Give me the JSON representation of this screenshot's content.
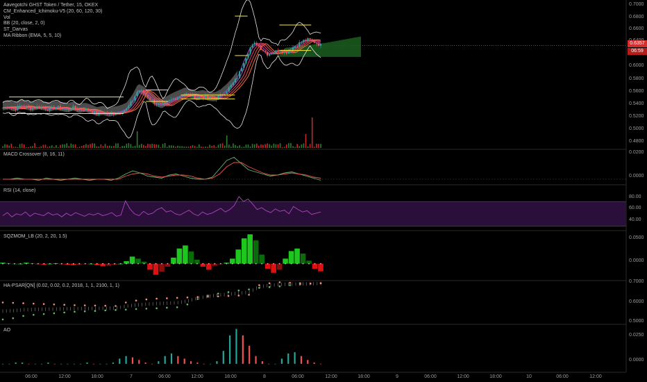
{
  "main_legend": [
    "Aavegotchi GHST Token / Tether, 15, OKEX",
    "CM_Enhanced_Ichimoku-V5 (20, 60, 120, 30)",
    "Vol",
    "BB (20, close, 2, 0)",
    "ST_Darvas",
    "MA Ribbon (EMA, 5, 5, 10)"
  ],
  "pane_labels": {
    "macd": "MACD Crossover (8, 16, 11)",
    "rsi": "RSI (14, close)",
    "sqzmom": "SQZMOM_LB (20, 2, 20, 1.5)",
    "hapsar": "HA-PSAR[QN] (0.02, 0.02, 0.2, 2018, 1, 1, 2100, 1, 1)",
    "ao": "AO"
  },
  "price_badge": "0.6357",
  "countdown_badge": "06:59",
  "y_ticks": {
    "main": [
      "0.7000",
      "0.6800",
      "0.6600",
      "0.6400",
      "0.6200",
      "0.6000",
      "0.5800",
      "0.5600",
      "0.5400",
      "0.5200",
      "0.5000",
      "0.4800"
    ],
    "macd": [
      "0.0200",
      "0.0000"
    ],
    "rsi": [
      "80.00",
      "60.00",
      "40.00"
    ],
    "sqzmom": [
      "0.0500",
      "0.0000"
    ],
    "hapsar": [
      "0.7000",
      "0.6000",
      "0.5000"
    ],
    "ao": [
      "0.0250",
      "0.0000"
    ]
  },
  "x_ticks": [
    "06:00",
    "12:00",
    "18:00",
    "7",
    "06:00",
    "12:00",
    "18:00",
    "8",
    "06:00",
    "12:00",
    "18:00",
    "9",
    "06:00",
    "12:00",
    "18:00",
    "10",
    "06:00",
    "12:00"
  ],
  "colors": {
    "up": "#26a69a",
    "down": "#ef5350",
    "bull_volume": "#2e7d32",
    "bear_volume": "#c62828",
    "rsi_line": "#ab47bc",
    "rsi_band": "#2a0f3a",
    "bb_band": "#e8e8e8",
    "darvas": "#ffeb3b",
    "cloud_gray": "#8a8a8a",
    "cloud_green": "#1b5e20",
    "psar_red": "#ff8a80",
    "psar_green": "#66bb6a"
  },
  "chart_data": [
    {
      "type": "candlestick",
      "title": "Aavegotchi GHST Token / Tether, 15, OKEX",
      "ylim": [
        0.475,
        0.705
      ],
      "x_session_ticks": [
        "06:00",
        "12:00",
        "18:00",
        "7",
        "06:00",
        "12:00",
        "18:00",
        "8",
        "06:00",
        "12:00",
        "18:00",
        "9",
        "06:00",
        "12:00",
        "18:00",
        "10",
        "06:00",
        "12:00"
      ],
      "close_path": [
        0.538,
        0.54,
        0.536,
        0.541,
        0.539,
        0.537,
        0.54,
        0.538,
        0.536,
        0.539,
        0.537,
        0.535,
        0.538,
        0.534,
        0.536,
        0.533,
        0.529,
        0.531,
        0.528,
        0.53,
        0.532,
        0.536,
        0.548,
        0.566,
        0.561,
        0.552,
        0.545,
        0.541,
        0.547,
        0.552,
        0.556,
        0.56,
        0.557,
        0.554,
        0.556,
        0.553,
        0.552,
        0.557,
        0.565,
        0.575,
        0.588,
        0.612,
        0.632,
        0.64,
        0.63,
        0.622,
        0.625,
        0.629,
        0.624,
        0.631,
        0.637,
        0.643,
        0.645,
        0.641,
        0.636
      ],
      "last_price": 0.6357,
      "darvas_levels": [
        [
          0.555,
          0.529
        ],
        [
          0.566,
          0.548
        ],
        [
          0.558,
          0.552
        ],
        [
          0.682,
          0.62
        ],
        [
          0.668,
          0.628
        ]
      ]
    },
    {
      "type": "line",
      "title": "MACD Crossover (8, 16, 11)",
      "ylim": [
        -0.004,
        0.028
      ],
      "series": [
        {
          "values": [
            0.0,
            0.0,
            0.001,
            0.0,
            0.0,
            -0.001,
            0.001,
            0.0,
            -0.001,
            0.0,
            0.001,
            0.0,
            -0.001,
            0.0,
            0.0,
            -0.001,
            0.001,
            0.005,
            0.008,
            0.006,
            0.003,
            0.002,
            0.001,
            0.004,
            0.005,
            0.003,
            0.001,
            0.0,
            0.0,
            0.002,
            0.01,
            0.018,
            0.021,
            0.015,
            0.009,
            0.007,
            0.005,
            0.003,
            0.004,
            0.006,
            0.007,
            0.005,
            0.003,
            0.001,
            -0.001
          ]
        },
        {
          "values": [
            0.0,
            0.0,
            0.0,
            0.0,
            0.0,
            0.0,
            0.0,
            0.0,
            0.0,
            0.0,
            0.0,
            0.0,
            0.0,
            0.0,
            0.0,
            0.0,
            0.0,
            0.003,
            0.005,
            0.006,
            0.005,
            0.003,
            0.002,
            0.003,
            0.004,
            0.004,
            0.003,
            0.001,
            0.0,
            0.001,
            0.005,
            0.012,
            0.016,
            0.016,
            0.012,
            0.009,
            0.006,
            0.004,
            0.004,
            0.005,
            0.006,
            0.005,
            0.004,
            0.002,
            0.001
          ]
        }
      ]
    },
    {
      "type": "line",
      "title": "RSI (14, close)",
      "ylim": [
        25,
        95
      ],
      "band": [
        30,
        70
      ],
      "series": [
        {
          "values": [
            47,
            52,
            45,
            50,
            48,
            53,
            46,
            51,
            49,
            47,
            52,
            48,
            50,
            45,
            51,
            47,
            52,
            49,
            46,
            50,
            48,
            51,
            47,
            49,
            52,
            46,
            48,
            71,
            58,
            50,
            47,
            54,
            49,
            51,
            57,
            60,
            53,
            55,
            50,
            48,
            52,
            56,
            50,
            47,
            53,
            49,
            51,
            55,
            59,
            53,
            57,
            64,
            78,
            70,
            74,
            66,
            57,
            60,
            55,
            52,
            58,
            54,
            56,
            50,
            62,
            57,
            53,
            55,
            49,
            51,
            53
          ]
        }
      ]
    },
    {
      "type": "bar",
      "title": "SQZMOM_LB (20, 2, 20, 1.5)",
      "ylim": [
        -0.032,
        0.064
      ],
      "values": [
        0.002,
        0.001,
        0.0,
        0.0,
        0.002,
        0.001,
        -0.001,
        -0.002,
        0.0,
        0.001,
        -0.001,
        -0.002,
        -0.003,
        -0.002,
        -0.001,
        0.0,
        -0.003,
        -0.005,
        -0.004,
        -0.002,
        0.0,
        0.005,
        0.014,
        0.01,
        0.004,
        -0.012,
        -0.022,
        -0.016,
        -0.006,
        0.012,
        0.03,
        0.036,
        0.024,
        0.008,
        -0.006,
        -0.012,
        -0.004,
        -0.001,
        0.002,
        0.01,
        0.028,
        0.05,
        0.058,
        0.046,
        0.018,
        -0.01,
        -0.018,
        -0.012,
        0.01,
        0.025,
        0.03,
        0.02,
        0.006,
        -0.01,
        -0.015
      ]
    },
    {
      "type": "scatter",
      "title": "HA-PSAR[QN] (0.02, 0.02, 0.2, 2018, 1, 1, 2100, 1, 1)",
      "ylim": [
        0.49,
        0.71
      ],
      "series": [
        {
          "values": [
            0.512,
            0.518,
            0.53,
            0.536,
            0.54,
            0.544,
            0.548,
            0.552,
            0.554,
            0.556,
            0.559,
            0.561,
            0.563,
            0.566,
            0.568,
            0.57,
            0.573,
            0.575,
            0.59,
            0.618,
            0.636,
            0.646,
            0.654,
            0.662,
            0.668,
            0.676,
            0.68,
            0.684,
            0.69,
            0.694,
            0.698,
            0.7
          ]
        },
        {
          "values": [
            0.6,
            0.598,
            0.596,
            0.594,
            0.592,
            0.59,
            0.588,
            0.586,
            0.585,
            0.584,
            0.583,
            0.582,
            0.6,
            0.61,
            0.616,
            0.62,
            0.622,
            0.624,
            0.626,
            0.628,
            0.63,
            0.632,
            0.634,
            0.636,
            0.64,
            0.69,
            0.7,
            0.705,
            0.702,
            0.7,
            0.698,
            0.7
          ]
        }
      ]
    },
    {
      "type": "bar",
      "title": "AO",
      "ylim": [
        -0.006,
        0.03
      ],
      "values": [
        0.0,
        0.0,
        0.001,
        0.001,
        0.0,
        0.0,
        0.0,
        0.001,
        0.0,
        0.0,
        0.0,
        0.0,
        0.0,
        0.001,
        0.0,
        0.0,
        0.0,
        0.001,
        0.004,
        0.006,
        0.005,
        0.003,
        0.001,
        0.0,
        0.002,
        0.006,
        0.008,
        0.006,
        0.004,
        0.002,
        0.001,
        0.0,
        0.0,
        0.002,
        0.01,
        0.022,
        0.027,
        0.022,
        0.014,
        0.006,
        0.002,
        0.0,
        0.0,
        0.004,
        0.008,
        0.009,
        0.006,
        0.003,
        0.001,
        0.0
      ]
    }
  ]
}
